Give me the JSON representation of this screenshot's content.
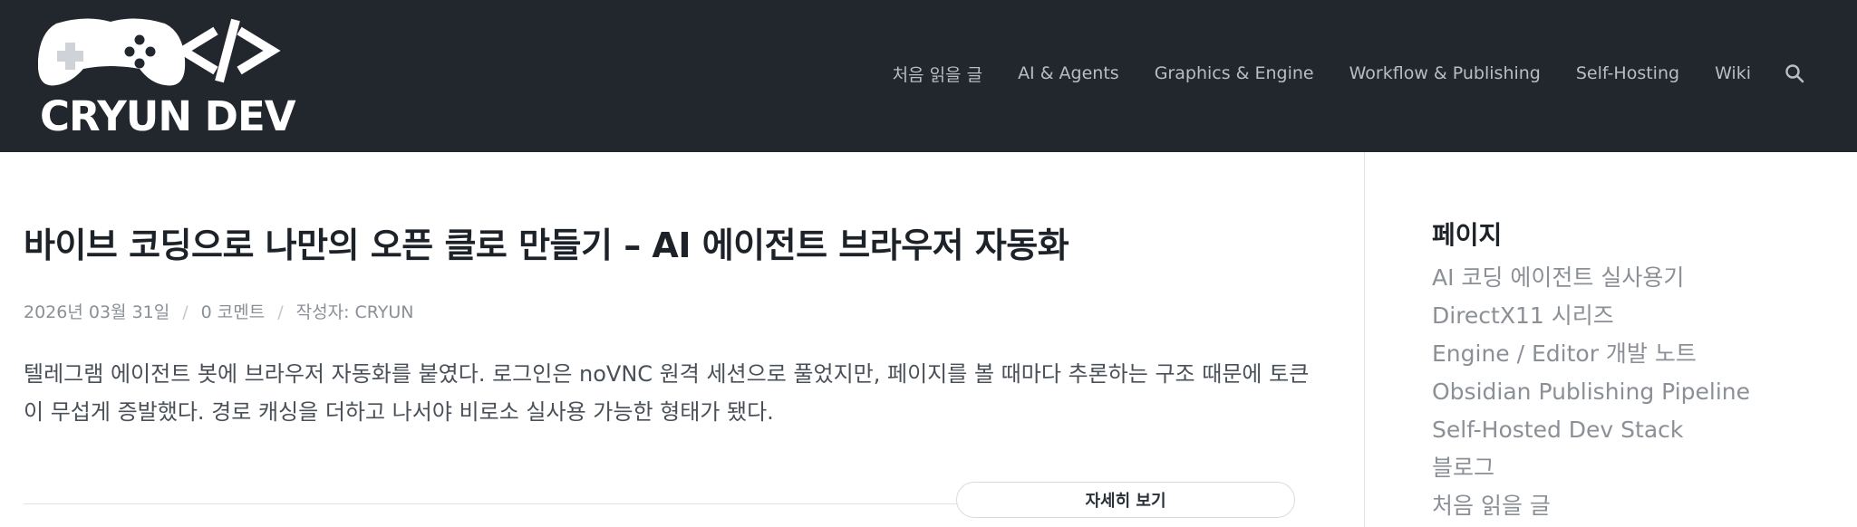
{
  "header": {
    "logo_text": "CRYUN DEV",
    "nav": [
      {
        "label": "처음 읽을 글"
      },
      {
        "label": "AI & Agents"
      },
      {
        "label": "Graphics & Engine"
      },
      {
        "label": "Workflow & Publishing"
      },
      {
        "label": "Self-Hosting"
      },
      {
        "label": "Wiki"
      }
    ],
    "search_icon": "search-icon"
  },
  "post": {
    "title": "바이브 코딩으로 나만의 오픈 클로 만들기 – AI 에이전트 브라우저 자동화",
    "meta": {
      "date": "2026년 03월 31일",
      "comments": "0 코멘트",
      "author": "작성자: CRYUN",
      "separator": "/"
    },
    "excerpt": "텔레그램 에이전트 봇에 브라우저 자동화를 붙였다. 로그인은 noVNC 원격 세션으로 풀었지만, 페이지를 볼 때마다 추론하는 구조 때문에 토큰이 무섭게 증발했다. 경로 캐싱을 더하고 나서야 비로소 실사용 가능한 형태가 됐다.",
    "read_more": "자세히 보기"
  },
  "sidebar": {
    "title": "페이지",
    "items": [
      {
        "label": "AI 코딩 에이전트 실사용기"
      },
      {
        "label": "DirectX11 시리즈"
      },
      {
        "label": "Engine / Editor 개발 노트"
      },
      {
        "label": "Obsidian Publishing Pipeline"
      },
      {
        "label": "Self-Hosted Dev Stack"
      },
      {
        "label": "블로그"
      },
      {
        "label": "처음 읽을 글"
      }
    ]
  },
  "colors": {
    "header_bg": "#22272e",
    "nav_text": "#b8bec6",
    "title_text": "#1c2228",
    "muted_text": "#8b9096"
  }
}
